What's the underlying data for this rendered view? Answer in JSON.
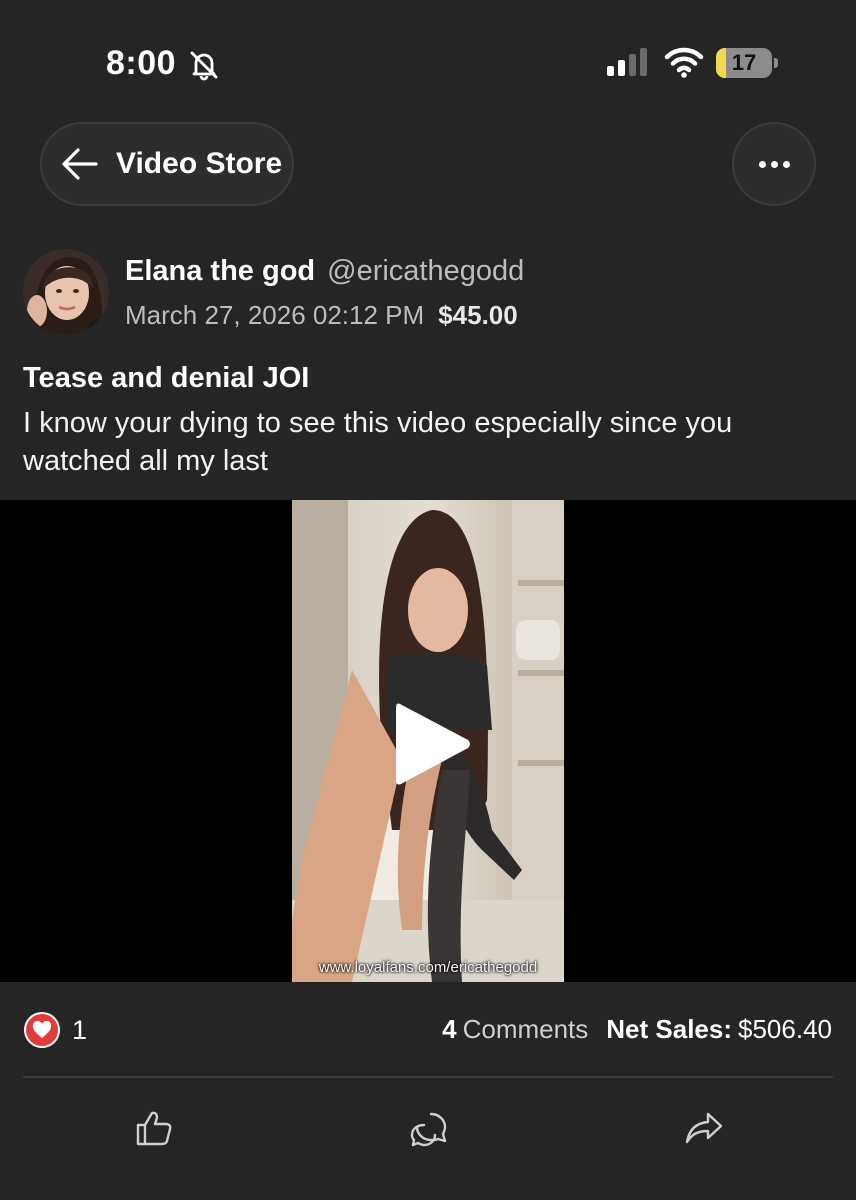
{
  "status_bar": {
    "time": "8:00",
    "battery": "17",
    "battery_level": 0.17,
    "icons": [
      "bell-slash-icon",
      "signal-icon",
      "wifi-icon",
      "battery-icon"
    ]
  },
  "header": {
    "back_label": "Video Store",
    "back_icon": "arrow-left-icon",
    "more_icon": "more-horizontal-icon"
  },
  "post": {
    "author_name": "Elana the god",
    "author_handle": "@ericathegodd",
    "date": "March 27, 2026 02:12 PM",
    "price": "$45.00",
    "title": "Tease and denial JOI",
    "description": "I know your dying to see this video especially since you watched all my last",
    "watermark": "www.loyalfans.com/ericathegodd"
  },
  "stats": {
    "likes": "1",
    "comments_count": "4",
    "comments_label": "Comments",
    "net_sales_label": "Net Sales:",
    "net_sales_value": "$506.40"
  },
  "actions": [
    "thumbs-up-icon",
    "comment-icon",
    "share-icon"
  ],
  "colors": {
    "background": "#252525",
    "like_badge": "#e23b3b",
    "battery_fill": "#f3d94d"
  }
}
